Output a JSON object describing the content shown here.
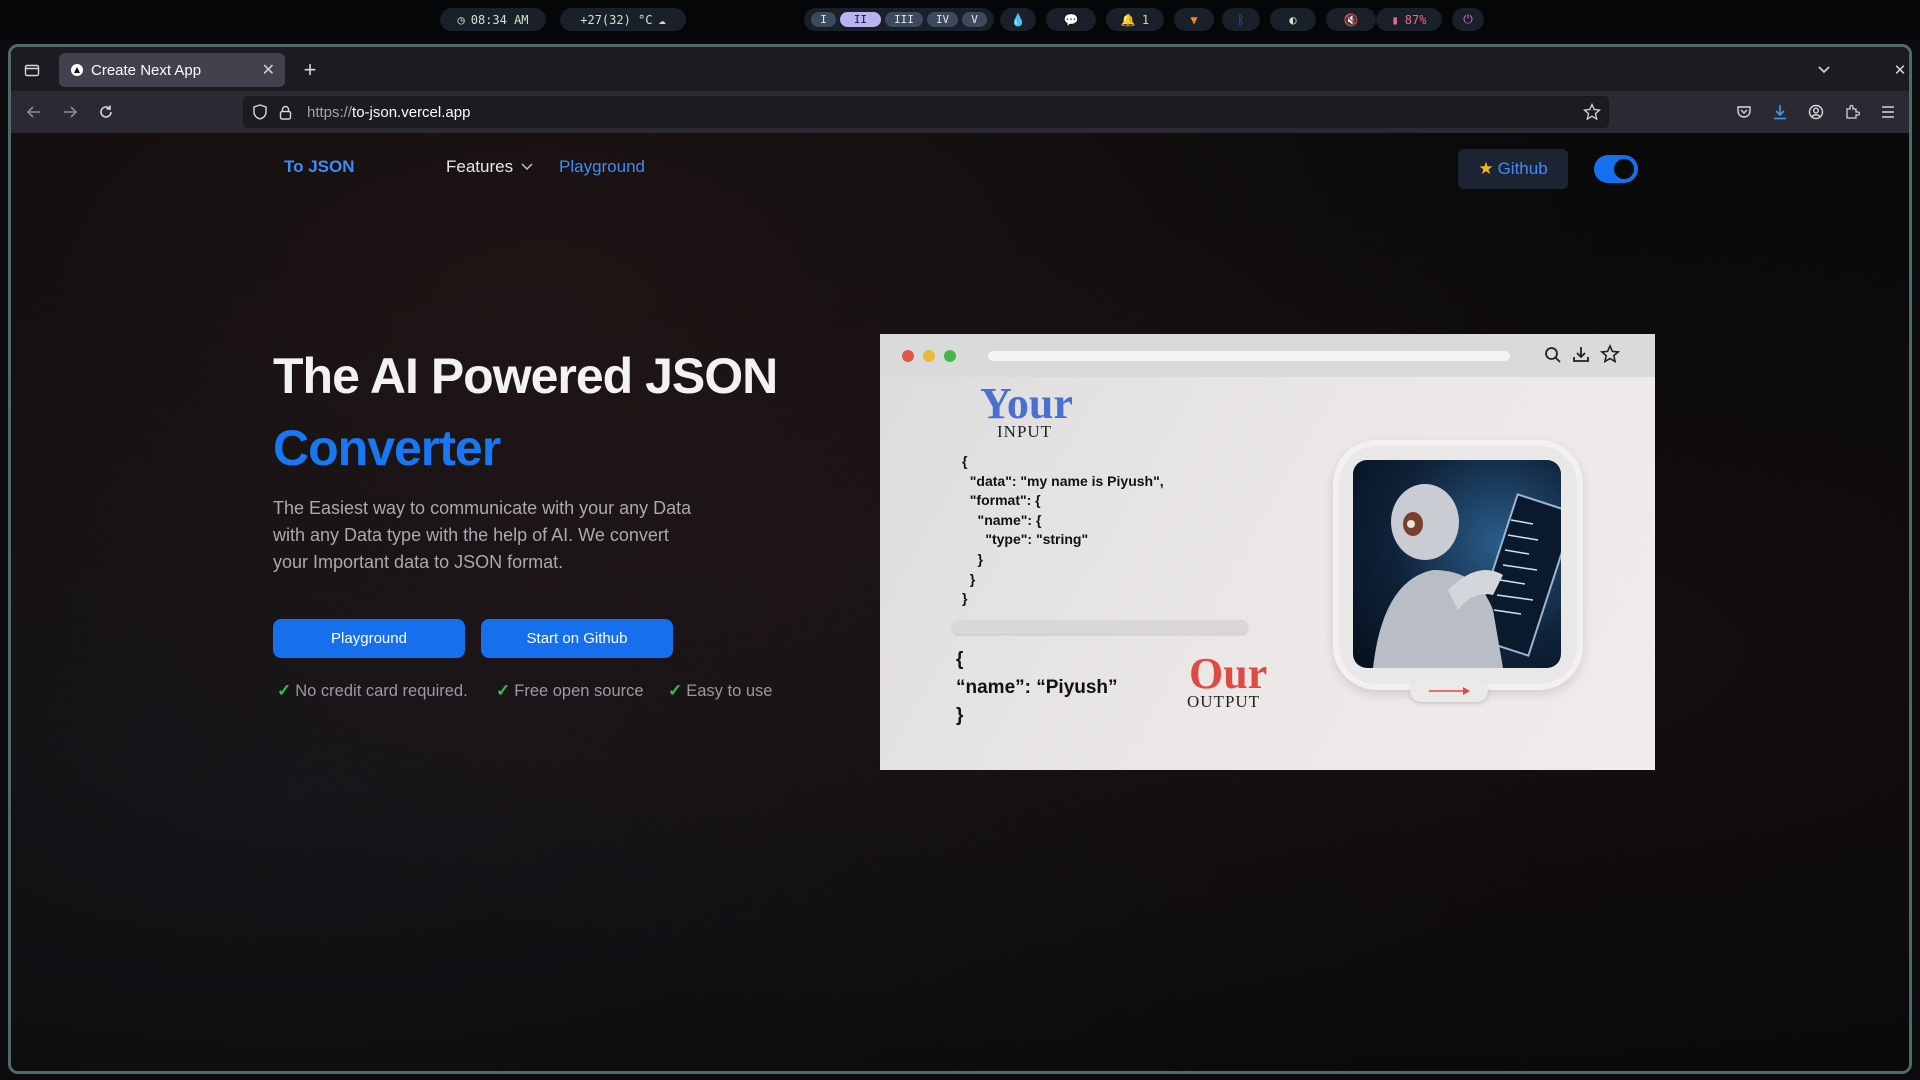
{
  "system_bar": {
    "clock": "08:34 AM",
    "weather": "+27(32) °C",
    "workspaces": [
      "I",
      "II",
      "III",
      "IV",
      "V"
    ],
    "active_workspace": "II",
    "notifications": "1",
    "battery": "87%"
  },
  "browser": {
    "tab_title": "Create Next App",
    "url_protocol": "https://",
    "url_host": "to-json.vercel.app"
  },
  "nav": {
    "brand": "To JSON",
    "features": "Features",
    "playground": "Playground",
    "github": "Github",
    "theme_toggle_on": true
  },
  "hero": {
    "title": "The AI Powered JSON",
    "accent": "Converter",
    "description": "The Easiest way to communicate with your any Data with any Data type with the help of AI. We convert your Important data to JSON format.",
    "buttons": {
      "playground": "Playground",
      "github": "Start on Github"
    },
    "checks": [
      "No credit card required.",
      "Free open source",
      "Easy to use"
    ]
  },
  "illustration": {
    "your": "Your",
    "input": "INPUT",
    "input_code": [
      "{",
      "  \"data\": \"my name is Piyush\",",
      "  \"format\": {",
      "    \"name\": {",
      "      \"type\": \"string\"",
      "    }",
      "  }",
      "}"
    ],
    "output_code": [
      "{",
      "“name”: “Piyush”",
      "}"
    ],
    "our": "Our",
    "output": "OUTPUT"
  },
  "colors": {
    "accent": "#1877f2",
    "button": "#1670ee",
    "check": "#2fbf57",
    "your_text": "#4a6fd0",
    "our_text": "#e04a45"
  }
}
